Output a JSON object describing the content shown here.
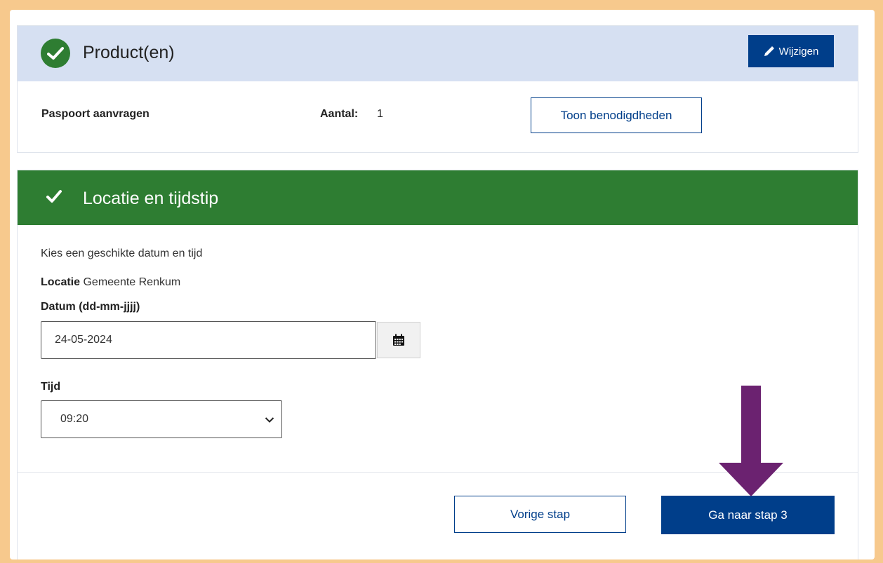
{
  "product_panel": {
    "title": "Product(en)",
    "edit_button": "Wijzigen",
    "product_name": "Paspoort aanvragen",
    "quantity_label": "Aantal:",
    "quantity_value": "1",
    "requirements_button": "Toon benodigdheden"
  },
  "location_panel": {
    "title": "Locatie en tijdstip",
    "intro": "Kies een geschikte datum en tijd",
    "location_label": "Locatie",
    "location_value": "Gemeente Renkum",
    "date_label": "Datum (dd-mm-jjjj)",
    "date_value": "24-05-2024",
    "time_label": "Tijd",
    "time_value": "09:20",
    "prev_button": "Vorige stap",
    "next_button": "Ga naar stap 3"
  },
  "icons": {
    "completed": "check-circle-icon",
    "edit": "pencil-icon",
    "calendar": "calendar-icon",
    "dropdown": "chevron-down-icon",
    "annotation": "down-arrow-icon"
  },
  "colors": {
    "frame": "#f7c98d",
    "header_light": "#d6e0f2",
    "header_green": "#2e7d32",
    "primary": "#003e8a",
    "annotation_arrow": "#6b2270"
  }
}
